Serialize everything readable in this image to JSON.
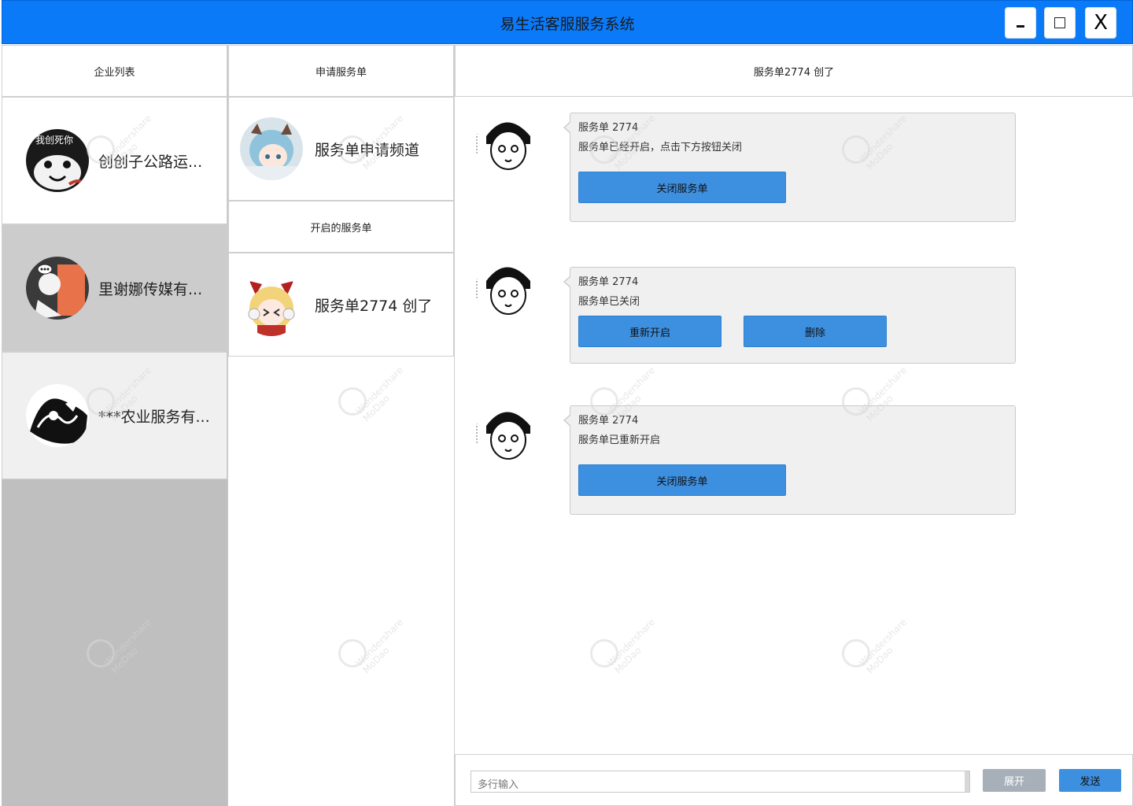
{
  "window": {
    "title": "易生活客服服务系统",
    "minimize_label": "-",
    "close_label": "X"
  },
  "companies": {
    "header": "企业列表",
    "items": [
      {
        "name": "创创子公路运...",
        "avatar_text": "我创死你"
      },
      {
        "name": "里谢娜传媒有..."
      },
      {
        "name": "***农业服务有..."
      }
    ]
  },
  "orders": {
    "apply_header": "申请服务单",
    "apply_item": "服务单申请频道",
    "open_header": "开启的服务单",
    "open_item": "服务单2774 创了"
  },
  "chat": {
    "header": "服务单2774 创了",
    "messages": [
      {
        "title": "服务单 2774",
        "body": "服务单已经开启，点击下方按钮关闭",
        "buttons": [
          "关闭服务单"
        ]
      },
      {
        "title": "服务单 2774",
        "body": "服务单已关闭",
        "buttons": [
          "重新开启",
          "删除"
        ]
      },
      {
        "title": "服务单 2774",
        "body": "服务单已重新开启",
        "buttons": [
          "关闭服务单"
        ]
      }
    ]
  },
  "input": {
    "placeholder": "多行输入",
    "expand_label": "展开",
    "send_label": "发送"
  },
  "watermark": {
    "line1": "Wondershare",
    "line2": "MoDao"
  },
  "colors": {
    "titlebar": "#0a7af8",
    "button_primary": "#3d8fe0",
    "button_secondary": "#a7b0b9",
    "sidebar_bg": "#bfbfbf"
  }
}
